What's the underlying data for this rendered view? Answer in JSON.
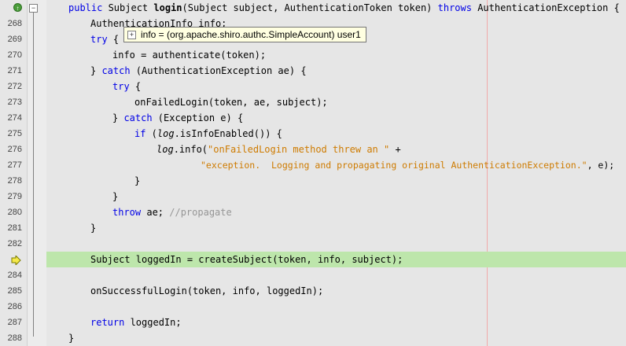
{
  "gutter": {
    "line_numbers": [
      "",
      "268",
      "269",
      "270",
      "271",
      "272",
      "273",
      "274",
      "275",
      "276",
      "277",
      "278",
      "279",
      "280",
      "281",
      "282",
      "",
      "284",
      "285",
      "286",
      "287",
      "288"
    ]
  },
  "tooltip": {
    "text": "info = (org.apache.shiro.authc.SimpleAccount) user1",
    "expand_glyph": "+"
  },
  "code": {
    "l0_a": "public",
    "l0_b": " Subject ",
    "l0_c": "login",
    "l0_d": "(Subject subject, AuthenticationToken token) ",
    "l0_e": "throws",
    "l0_f": " AuthenticationException {",
    "l1": "AuthenticationInfo info;",
    "l2_a": "try",
    "l2_b": " {",
    "l3": "info = authenticate(token);",
    "l4_a": "} ",
    "l4_b": "catch",
    "l4_c": " (AuthenticationException ae) {",
    "l5_a": "try",
    "l5_b": " {",
    "l6": "onFailedLogin(token, ae, subject);",
    "l7_a": "} ",
    "l7_b": "catch",
    "l7_c": " (Exception e) {",
    "l8_a": "if",
    "l8_b": " (",
    "l8_c": "log",
    "l8_d": ".isInfoEnabled()) {",
    "l9_a": "log",
    "l9_b": ".info(",
    "l9_c": "\"onFailedLogin method threw an \"",
    "l9_d": " +",
    "l10_a": "\"exception.  Logging and propagating original AuthenticationException.\"",
    "l10_b": ", e);",
    "l11": "}",
    "l12": "}",
    "l13_a": "throw",
    "l13_b": " ae; ",
    "l13_c": "//propagate",
    "l14": "}",
    "l16": "Subject loggedIn = createSubject(token, info, subject);",
    "l18": "onSuccessfulLogin(token, info, loggedIn);",
    "l20_a": "return",
    "l20_b": " loggedIn;",
    "l21": "}"
  },
  "colors": {
    "keyword": "#0000e6",
    "string": "#ce7b00",
    "comment": "#969696",
    "current_line": "#bde6ab",
    "margin_line": "#f1a9a9"
  }
}
